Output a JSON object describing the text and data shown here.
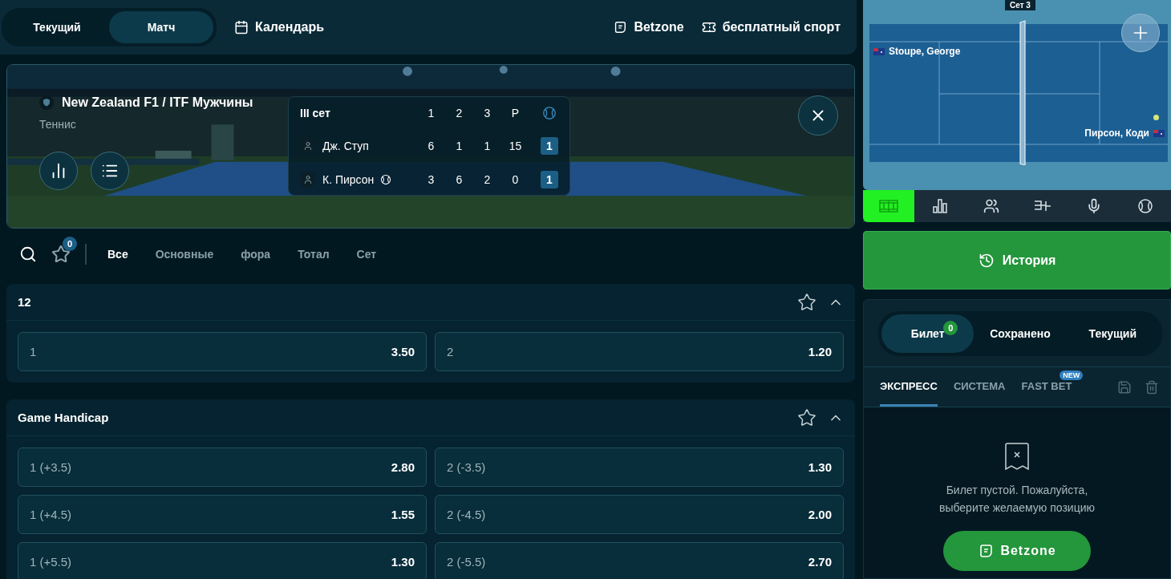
{
  "top_nav": {
    "tabs": [
      {
        "label": "Текущий",
        "selected": false
      },
      {
        "label": "Матч",
        "selected": true
      }
    ],
    "calendar": "Календарь",
    "links": [
      {
        "kind": "betzone",
        "label": "Betzone"
      },
      {
        "kind": "ticket",
        "label": "бесплатный спорт"
      }
    ]
  },
  "match": {
    "tournament": "New Zealand F1 / ITF Мужчины",
    "sport": "Теннис",
    "scoreboard": {
      "period": "III сет",
      "columns": [
        "1",
        "2",
        "3",
        "P"
      ],
      "players": [
        {
          "name": "Дж. Ступ",
          "serving": false,
          "scores": [
            "6",
            "1",
            "1",
            "15"
          ],
          "sets": "1"
        },
        {
          "name": "К. Пирсон",
          "serving": true,
          "scores": [
            "3",
            "6",
            "2",
            "0"
          ],
          "sets": "1"
        }
      ]
    }
  },
  "filters": {
    "favorites_count": "0",
    "tabs": [
      {
        "label": "Все",
        "selected": true
      },
      {
        "label": "Основные",
        "selected": false
      },
      {
        "label": "фора",
        "selected": false
      },
      {
        "label": "Тотал",
        "selected": false
      },
      {
        "label": "Сет",
        "selected": false
      }
    ]
  },
  "markets": [
    {
      "title": "12",
      "expanded": true,
      "outcomes": [
        {
          "label": "1",
          "odds": "3.50"
        },
        {
          "label": "2",
          "odds": "1.20"
        }
      ]
    },
    {
      "title": "Game Handicap",
      "expanded": true,
      "outcomes": [
        {
          "label": "1 (+3.5)",
          "odds": "2.80"
        },
        {
          "label": "2 (-3.5)",
          "odds": "1.30"
        },
        {
          "label": "1 (+4.5)",
          "odds": "1.55"
        },
        {
          "label": "2 (-4.5)",
          "odds": "2.00"
        },
        {
          "label": "1 (+5.5)",
          "odds": "1.30"
        },
        {
          "label": "2 (-5.5)",
          "odds": "2.70"
        }
      ]
    }
  ],
  "tracker": {
    "set_label": "Сет 3",
    "players": [
      {
        "name": "Stoupe, George"
      },
      {
        "name": "Пирсон, Коди"
      }
    ],
    "tabs": [
      {
        "kind": "court",
        "selected": true
      },
      {
        "kind": "stats",
        "selected": false
      },
      {
        "kind": "lineups",
        "selected": false
      },
      {
        "kind": "bracket",
        "selected": false
      },
      {
        "kind": "commentary",
        "selected": false
      },
      {
        "kind": "ball",
        "selected": false
      }
    ]
  },
  "history_button": "История",
  "betslip": {
    "tabs": [
      {
        "label": "Билет",
        "badge": "0",
        "selected": true
      },
      {
        "label": "Сохранено",
        "selected": false
      },
      {
        "label": "Текущий",
        "selected": false
      }
    ],
    "bet_types": [
      {
        "label": "ЭКСПРЕСС",
        "selected": true
      },
      {
        "label": "СИСТЕМА",
        "selected": false
      },
      {
        "label": "FAST BET",
        "badge": "NEW",
        "selected": false
      }
    ],
    "empty_message": "Билет пустой. Пожалуйста, выберите желаемую позицию",
    "button": "Betzone"
  }
}
